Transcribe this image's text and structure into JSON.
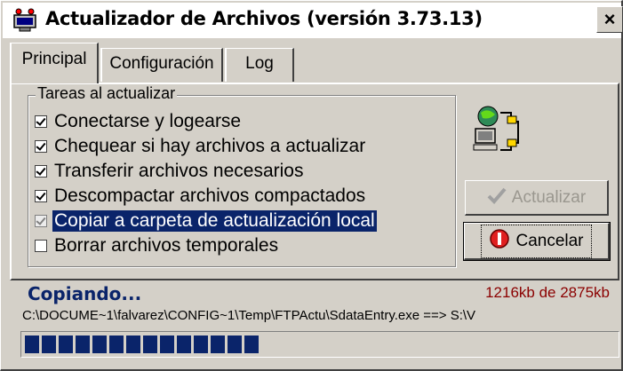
{
  "window": {
    "title": "Actualizador de Archivos (versión 3.73.13)",
    "close_label": "×"
  },
  "tabs": [
    {
      "label": "Principal",
      "active": true
    },
    {
      "label": "Configuración",
      "active": false
    },
    {
      "label": "Log",
      "active": false
    }
  ],
  "group": {
    "label": "Tareas al actualizar",
    "tasks": [
      {
        "label": "Conectarse y logearse",
        "checked": true
      },
      {
        "label": "Chequear si hay archivos a actualizar",
        "checked": true
      },
      {
        "label": "Transferir archivos necesarios",
        "checked": true
      },
      {
        "label": "Descompactar archivos compactados",
        "checked": true
      },
      {
        "label": "Copiar a carpeta de actualización local",
        "checked": true,
        "selected": true,
        "disabled": true
      },
      {
        "label": "Borrar archivos temporales",
        "checked": false
      }
    ]
  },
  "buttons": {
    "actualizar_label": "Actualizar",
    "cancelar_label": "Cancelar"
  },
  "status": {
    "text": "Copiando...",
    "progress_text": "1216kb de 2875kb",
    "path": "C:\\DOCUME~1\\falvarez\\CONFIG~1\\Temp\\FTPActu\\SdataEntry.exe ==> S:\\V",
    "progress_fraction": 0.423
  },
  "colors": {
    "selection": "#0a246a",
    "status_text": "#0a246a",
    "progress_text": "#8b0000",
    "window_bg": "#d4d0c8"
  },
  "icons": {
    "title": "network-transfer-icon",
    "computers": "network-computers-icon",
    "actualizar": "checkmark-icon",
    "cancelar": "stop-icon"
  }
}
